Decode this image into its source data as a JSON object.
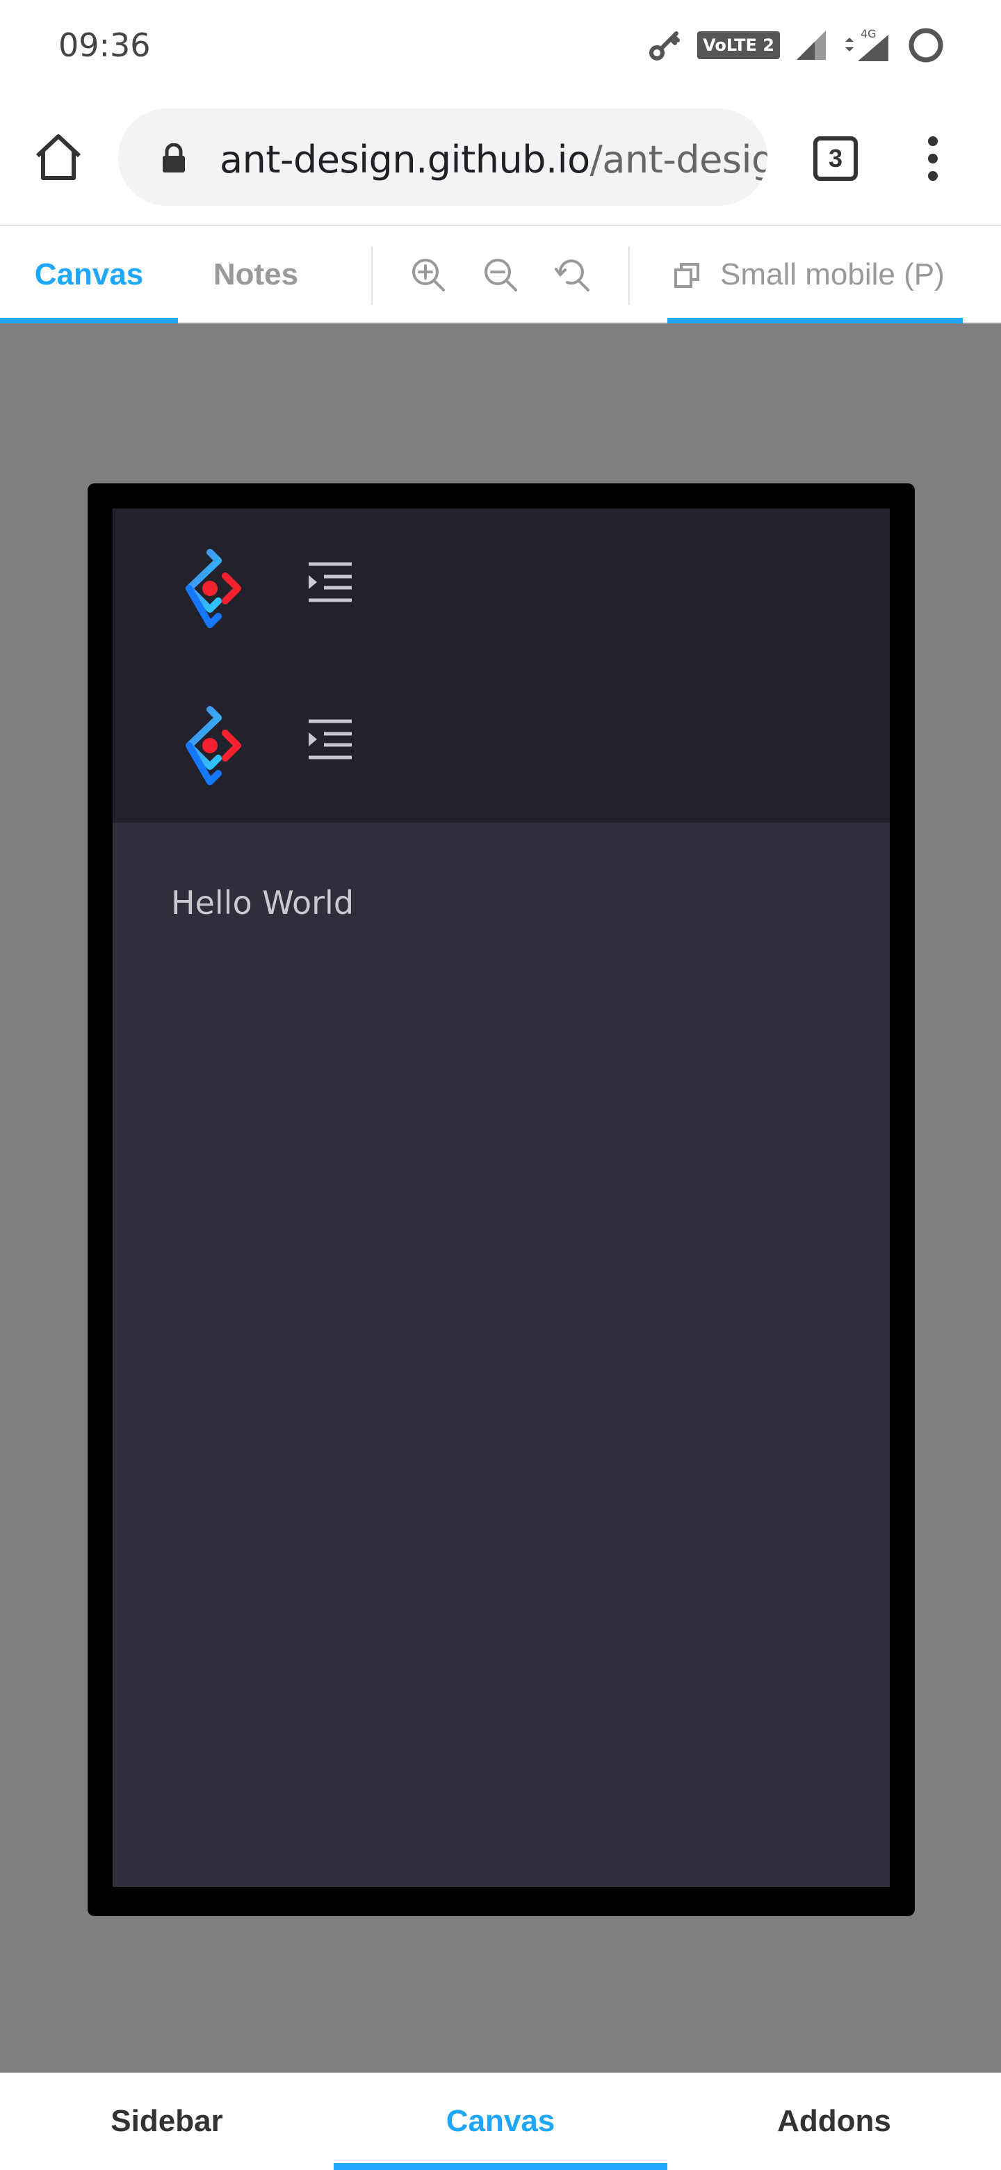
{
  "status_bar": {
    "time": "09:36",
    "volte_label": "VoLTE 2",
    "network_label": "4G"
  },
  "browser": {
    "url_host": "ant-design.github.io",
    "url_path": "/ant-design",
    "tab_count": "3"
  },
  "storybook_toolbar": {
    "tabs": [
      {
        "label": "Canvas",
        "active": true
      },
      {
        "label": "Notes",
        "active": false
      }
    ],
    "tools": [
      "zoom-in-icon",
      "zoom-out-icon",
      "reset-zoom-icon"
    ],
    "viewport_label": "Small mobile (P)",
    "accent_color": "#1ea7fd"
  },
  "preview": {
    "header_rows": [
      {
        "logo": "ant-design-logo-icon",
        "toggle": "menu-fold-icon"
      },
      {
        "logo": "ant-design-logo-icon",
        "toggle": "menu-fold-icon"
      }
    ],
    "content_text": "Hello World",
    "colors": {
      "header_bg": "#22212c",
      "content_bg": "#2f2e3b"
    }
  },
  "bottom_nav": {
    "items": [
      {
        "label": "Sidebar",
        "active": false
      },
      {
        "label": "Canvas",
        "active": true
      },
      {
        "label": "Addons",
        "active": false
      }
    ]
  }
}
